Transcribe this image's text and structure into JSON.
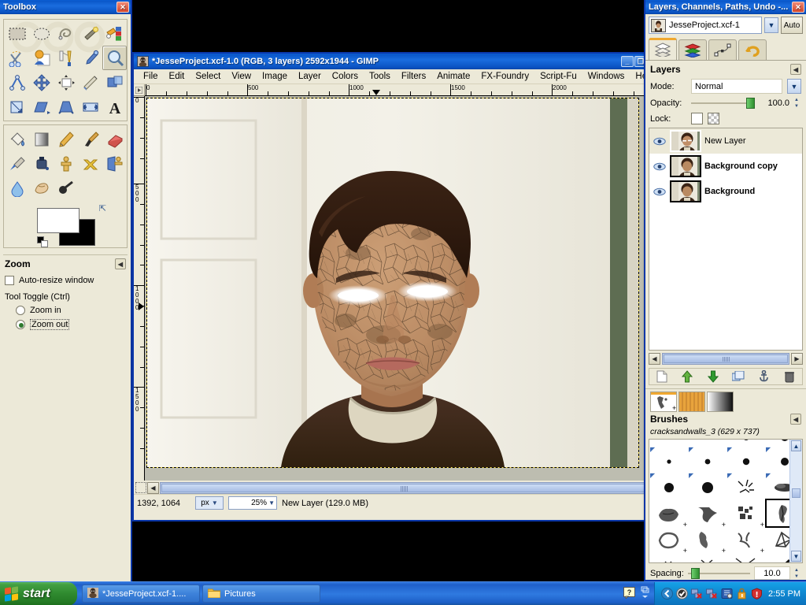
{
  "toolbox": {
    "title": "Toolbox",
    "close_label": "✕",
    "tools": [
      {
        "name": "rect-select-tool",
        "label": "Rectangle Select"
      },
      {
        "name": "ellipse-select-tool",
        "label": "Ellipse Select"
      },
      {
        "name": "free-select-tool",
        "label": "Free Select"
      },
      {
        "name": "fuzzy-select-tool",
        "label": "Fuzzy Select"
      },
      {
        "name": "select-by-color-tool",
        "label": "Select by Color"
      },
      {
        "name": "scissors-select-tool",
        "label": "Scissors Select"
      },
      {
        "name": "foreground-select-tool",
        "label": "Foreground Select"
      },
      {
        "name": "paths-tool",
        "label": "Paths"
      },
      {
        "name": "color-picker-tool",
        "label": "Color Picker"
      },
      {
        "name": "zoom-tool",
        "label": "Zoom"
      },
      {
        "name": "measure-tool",
        "label": "Measure"
      },
      {
        "name": "move-tool",
        "label": "Move"
      },
      {
        "name": "align-tool",
        "label": "Alignment"
      },
      {
        "name": "crop-tool",
        "label": "Crop"
      },
      {
        "name": "rotate-tool",
        "label": "Rotate"
      },
      {
        "name": "scale-tool",
        "label": "Scale"
      },
      {
        "name": "shear-tool",
        "label": "Shear"
      },
      {
        "name": "perspective-tool",
        "label": "Perspective"
      },
      {
        "name": "flip-tool",
        "label": "Flip"
      },
      {
        "name": "text-tool",
        "label": "Text"
      },
      {
        "name": "bucket-fill-tool",
        "label": "Bucket Fill"
      },
      {
        "name": "gradient-tool",
        "label": "Blend"
      },
      {
        "name": "pencil-tool",
        "label": "Pencil"
      },
      {
        "name": "paintbrush-tool",
        "label": "Paintbrush"
      },
      {
        "name": "eraser-tool",
        "label": "Eraser"
      },
      {
        "name": "airbrush-tool",
        "label": "Airbrush"
      },
      {
        "name": "ink-tool",
        "label": "Ink"
      },
      {
        "name": "clone-tool",
        "label": "Clone"
      },
      {
        "name": "heal-tool",
        "label": "Heal"
      },
      {
        "name": "perspective-clone-tool",
        "label": "Perspective Clone"
      },
      {
        "name": "blur-sharpen-tool",
        "label": "Blur / Sharpen"
      },
      {
        "name": "smudge-tool",
        "label": "Smudge"
      },
      {
        "name": "dodge-burn-tool",
        "label": "Dodge / Burn"
      }
    ],
    "active_tool": "zoom-tool",
    "colors": {
      "foreground": "#ffffff",
      "background": "#000000"
    },
    "tool_options": {
      "title": "Zoom",
      "collapse_label": "◀",
      "auto_resize_label": "Auto-resize window",
      "auto_resize_checked": false,
      "tool_toggle_label": "Tool Toggle  (Ctrl)",
      "options": [
        {
          "label": "Zoom in",
          "selected": false
        },
        {
          "label": "Zoom out",
          "selected": true
        }
      ]
    }
  },
  "gimp_window": {
    "title": "*JesseProject.xcf-1.0 (RGB, 3 layers) 2592x1944 - GIMP",
    "minimize_label": "_",
    "maximize_label": "❐",
    "menu": [
      "File",
      "Edit",
      "Select",
      "View",
      "Image",
      "Layer",
      "Colors",
      "Tools",
      "Filters",
      "Animate",
      "FX-Foundry",
      "Script-Fu",
      "Windows",
      "Help"
    ],
    "h_ruler_labels": [
      "0",
      "500",
      "1000",
      "1500",
      "2000"
    ],
    "v_ruler_labels": [
      "0",
      "500",
      "1000",
      "1500"
    ],
    "status": {
      "pointer_position": "1392, 1064",
      "unit": "px",
      "zoom": "25%",
      "message": "New Layer (129.0 MB)"
    }
  },
  "dock": {
    "title": "Layers, Channels, Paths, Undo -...",
    "close_label": "✕",
    "image_selector": {
      "value": "JesseProject.xcf-1",
      "auto_label": "Auto"
    },
    "tabs": [
      {
        "name": "layers-tab",
        "label": "Layers"
      },
      {
        "name": "channels-tab",
        "label": "Channels"
      },
      {
        "name": "paths-tab",
        "label": "Paths"
      },
      {
        "name": "undo-history-tab",
        "label": "Undo History"
      }
    ],
    "active_tab": "layers-tab",
    "layers_panel": {
      "title": "Layers",
      "collapse_label": "◀",
      "mode_label": "Mode:",
      "mode_value": "Normal",
      "opacity_label": "Opacity:",
      "opacity_value": "100.0",
      "lock_label": "Lock:",
      "layers": [
        {
          "name": "New Layer",
          "selected": true,
          "visible": true
        },
        {
          "name": "Background copy",
          "selected": false,
          "visible": true
        },
        {
          "name": "Background",
          "selected": false,
          "visible": true
        }
      ],
      "buttons": [
        {
          "name": "new-layer-button",
          "label": "New Layer"
        },
        {
          "name": "raise-layer-button",
          "label": "Raise Layer"
        },
        {
          "name": "lower-layer-button",
          "label": "Lower Layer"
        },
        {
          "name": "duplicate-layer-button",
          "label": "Duplicate Layer"
        },
        {
          "name": "anchor-layer-button",
          "label": "Anchor Layer"
        },
        {
          "name": "delete-layer-button",
          "label": "Delete Layer"
        }
      ]
    },
    "brushes_panel": {
      "tabs": [
        {
          "name": "brushes-tab",
          "label": "Brushes"
        },
        {
          "name": "patterns-tab",
          "label": "Patterns"
        },
        {
          "name": "gradients-tab",
          "label": "Gradients"
        }
      ],
      "active_tab": "brushes-tab",
      "title": "Brushes",
      "collapse_label": "◀",
      "selected_brush": "cracksandwalls_3 (629 x 737)",
      "spacing_label": "Spacing:",
      "spacing_value": "10.0"
    }
  },
  "taskbar": {
    "start_label": "start",
    "tasks": [
      {
        "name": "taskbar-item-gimp",
        "label": "*JesseProject.xcf-1...."
      },
      {
        "name": "taskbar-item-pictures",
        "label": "Pictures"
      }
    ],
    "clock": "2:55 PM"
  },
  "colors": {
    "xp_blue": "#0a57c9",
    "taskbar_blue": "#2f7ae0",
    "start_green": "#2f8a2f",
    "gimp_chrome": "#ece9d8",
    "accent_orange": "#f0a830"
  }
}
